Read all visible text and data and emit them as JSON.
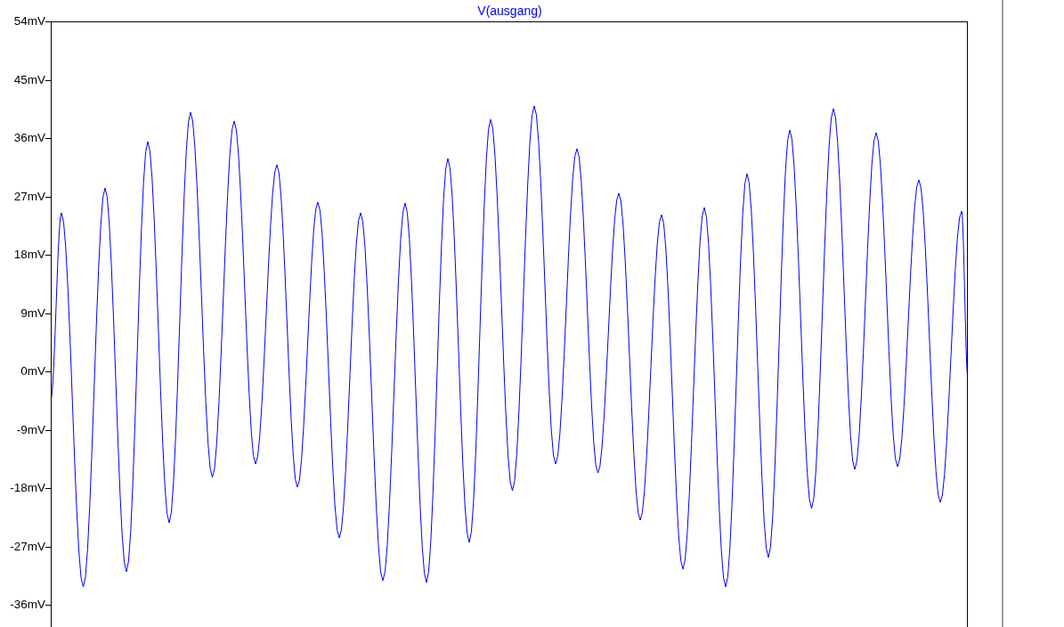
{
  "plot": {
    "title": "V(ausgang)",
    "y_ticks": [
      "54mV",
      "45mV",
      "36mV",
      "27mV",
      "18mV",
      "9mV",
      "0mV",
      "-9mV",
      "-18mV",
      "-27mV",
      "-36mV"
    ]
  }
}
